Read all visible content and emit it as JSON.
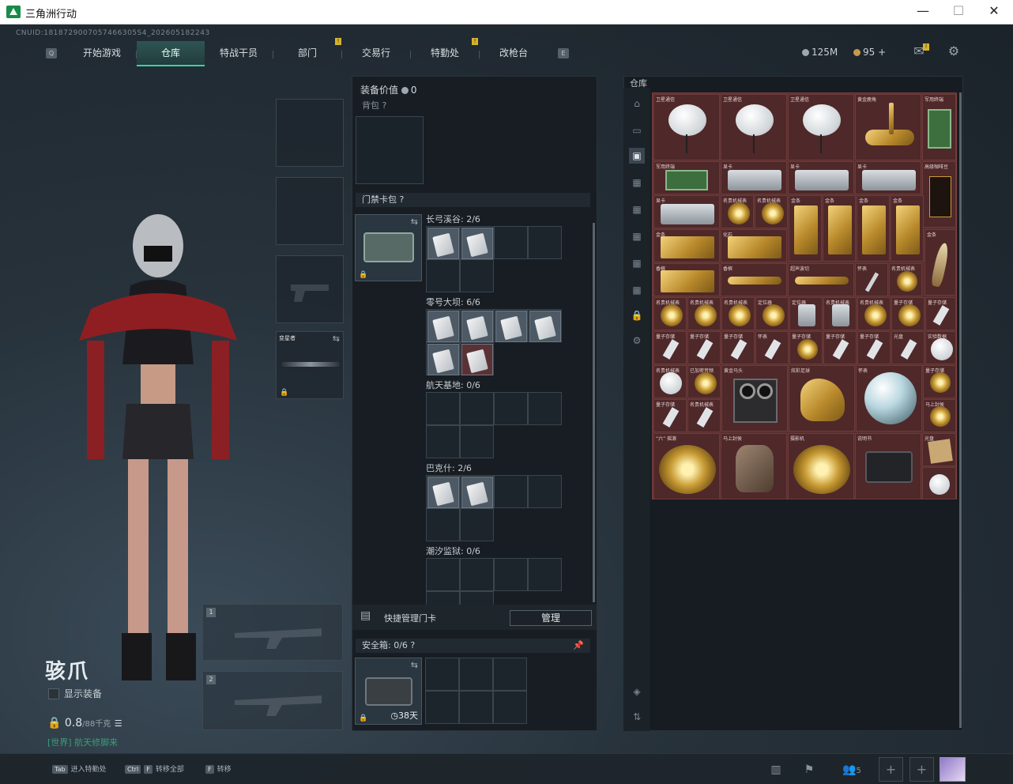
{
  "window": {
    "title": "三角洲行动",
    "minimize": "—",
    "maximize": "☐",
    "close": "✕"
  },
  "header": {
    "cnuid": "CNUID:1818729007057466305S4_202605182243",
    "tabs": [
      "开始游戏",
      "仓库",
      "特战干员",
      "部门",
      "交易行",
      "特勤处",
      "改枪台"
    ],
    "active_tab": "仓库",
    "currency_silver": "125M",
    "currency_gold": "95",
    "currency_gold_add": "+"
  },
  "character": {
    "name": "骇爪",
    "show_equipment": "显示装备",
    "weight_value": "0.8",
    "weight_max": "/88千克",
    "location_prefix": "[世界]",
    "location_text": "航天修脚来"
  },
  "equip": {
    "melee_label": "变星者",
    "weapon_slot_1": "1",
    "weapon_slot_2": "2"
  },
  "middle": {
    "value_label": "装备价值",
    "value_amount": "0",
    "backpack_label": "背包",
    "cardpack_label": "门禁卡包",
    "help": "?",
    "zones": [
      {
        "label": "长弓溪谷: 2/6"
      },
      {
        "label": "零号大坝: 6/6"
      },
      {
        "label": "航天基地: 0/6"
      },
      {
        "label": "巴克什: 2/6"
      },
      {
        "label": "潮汐监狱: 0/6"
      }
    ],
    "quick_manage": "快捷管理门卡",
    "manage_button": "管理",
    "safebox_label": "安全箱: 0/6",
    "safebox_days": "38天"
  },
  "warehouse": {
    "title": "仓库",
    "items": [
      {
        "label": "卫星通信"
      },
      {
        "label": "卫星通信"
      },
      {
        "label": "卫星通信"
      },
      {
        "label": "黄金鹿角"
      },
      {
        "label": "军用终端"
      },
      {
        "label": "军用终端"
      },
      {
        "label": "显卡"
      },
      {
        "label": "显卡"
      },
      {
        "label": "显卡"
      },
      {
        "label": "高级咖啡豆"
      },
      {
        "label": "显卡"
      },
      {
        "label": "名贵机械表"
      },
      {
        "label": "名贵机械表"
      },
      {
        "label": "金条"
      },
      {
        "label": "金条"
      },
      {
        "label": "金条"
      },
      {
        "label": "金条"
      },
      {
        "label": "金条"
      },
      {
        "label": "化石"
      },
      {
        "label": "金条"
      },
      {
        "label": "香槟"
      },
      {
        "label": "香槟"
      },
      {
        "label": "超声波切"
      },
      {
        "label": "怀表"
      },
      {
        "label": "名贵机械表"
      },
      {
        "label": "名贵机械表"
      },
      {
        "label": "名贵机械表"
      },
      {
        "label": "名贵机械表"
      },
      {
        "label": "定位器"
      },
      {
        "label": "定位器"
      },
      {
        "label": "名贵机械表"
      },
      {
        "label": "名贵机械表"
      },
      {
        "label": "量子存储"
      },
      {
        "label": "量子存储"
      },
      {
        "label": "量子存储"
      },
      {
        "label": "量子存储"
      },
      {
        "label": "量子存储"
      },
      {
        "label": "怀表"
      },
      {
        "label": "量子存储"
      },
      {
        "label": "量子存储"
      },
      {
        "label": "量子存储"
      },
      {
        "label": "光盘"
      },
      {
        "label": "实验数据"
      },
      {
        "label": "名贵机械表"
      },
      {
        "label": "已加密音频"
      },
      {
        "label": "黄金马头"
      },
      {
        "label": "炫彩足球"
      },
      {
        "label": "怀表"
      },
      {
        "label": "量子存储"
      },
      {
        "label": "量子存储"
      },
      {
        "label": "名贵机械表"
      },
      {
        "label": "马上封侯"
      },
      {
        "label": "“六” 摇滚"
      },
      {
        "label": "马上封侯"
      },
      {
        "label": "摄影机"
      },
      {
        "label": "说明书"
      },
      {
        "label": "光盘"
      }
    ]
  },
  "bottom": {
    "hotkeys": [
      {
        "key": "Tab",
        "label": "进入特勤处"
      },
      {
        "key": "Ctrl",
        "key2": "F",
        "label": "转移全部"
      },
      {
        "key": "F",
        "label": "转移"
      }
    ],
    "friends_count": "5",
    "add": "+"
  },
  "colors": {
    "accent": "#3fd0a5",
    "warehouse_bg": "#5a2f2f",
    "gold": "#c49a4a"
  }
}
